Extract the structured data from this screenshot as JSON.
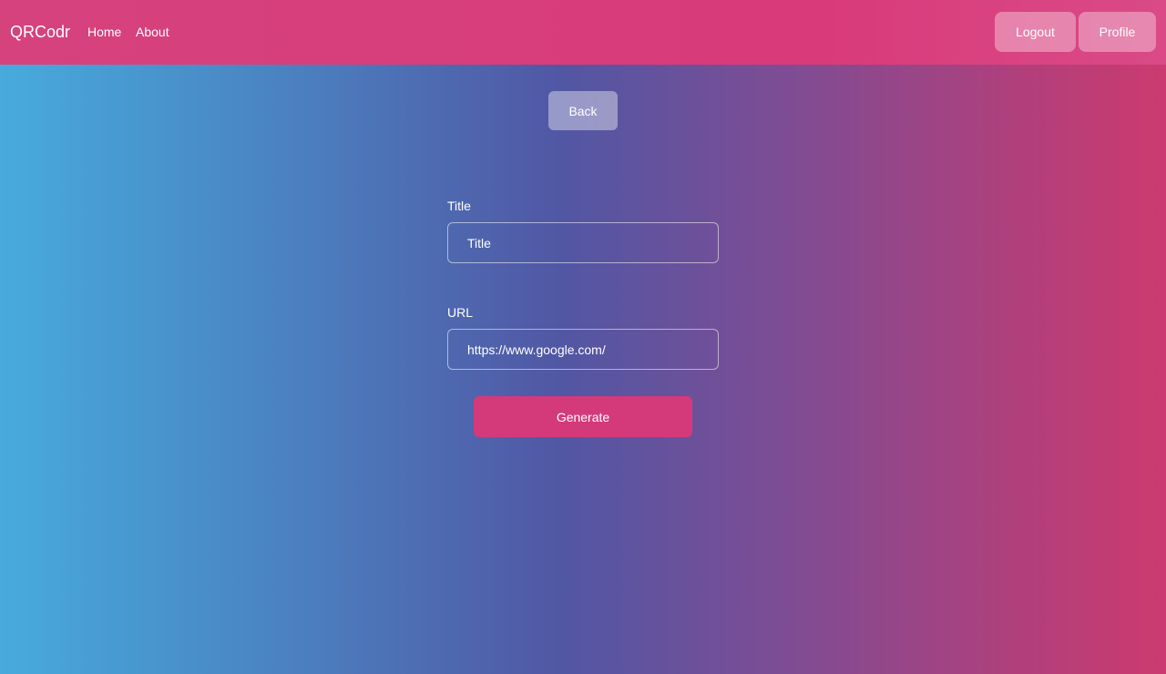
{
  "navbar": {
    "brand": "QRCodr",
    "links": {
      "home": "Home",
      "about": "About"
    },
    "logout_label": "Logout",
    "profile_label": "Profile"
  },
  "actions": {
    "back_label": "Back",
    "generate_label": "Generate"
  },
  "form": {
    "title": {
      "label": "Title",
      "placeholder": "Title",
      "value": ""
    },
    "url": {
      "label": "URL",
      "placeholder": "",
      "value": "https://www.google.com/"
    }
  },
  "colors": {
    "navbar": "#d93a7a",
    "generate_button": "#d43a7a",
    "gradient_left": "#47abdd",
    "gradient_mid": "#5157a4",
    "gradient_right": "#cb3b6f"
  }
}
